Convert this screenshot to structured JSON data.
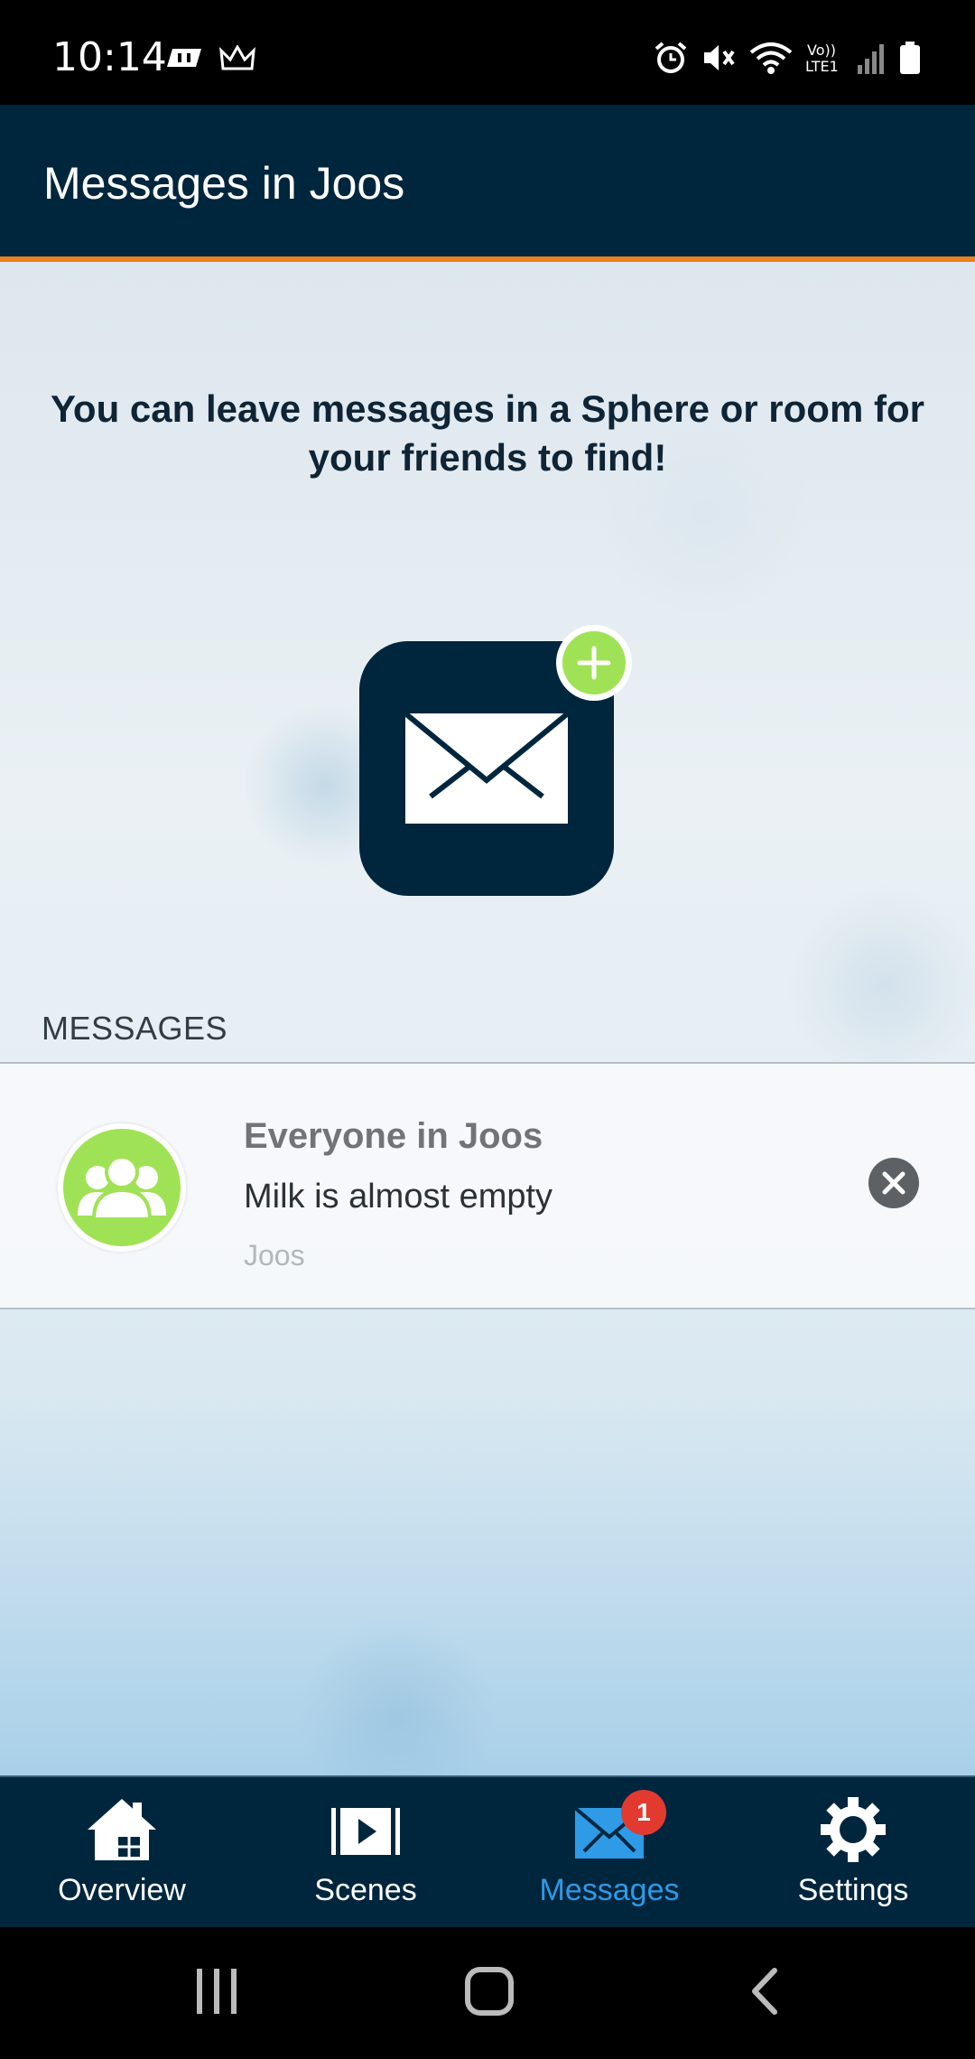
{
  "status_bar": {
    "time": "10:14",
    "icons": [
      "tools-icon",
      "crown-icon",
      "alarm-icon",
      "mute-icon",
      "wifi-icon",
      "volte-icon",
      "signal-icon",
      "battery-icon"
    ]
  },
  "header": {
    "title": "Messages in Joos"
  },
  "intro": {
    "text": "You can leave messages in a Sphere or room for your friends to find!"
  },
  "add_message_icon": "mail-add-icon",
  "messages_section": {
    "label": "MESSAGES",
    "items": [
      {
        "recipient": "Everyone in Joos",
        "body": "Milk is almost empty",
        "sphere": "Joos",
        "avatar_icon": "group-icon"
      }
    ]
  },
  "tabbar": {
    "tabs": [
      {
        "label": "Overview",
        "icon": "home-icon",
        "active": false
      },
      {
        "label": "Scenes",
        "icon": "scenes-icon",
        "active": false
      },
      {
        "label": "Messages",
        "icon": "mail-icon",
        "active": true,
        "badge": "1"
      },
      {
        "label": "Settings",
        "icon": "gear-icon",
        "active": false
      }
    ]
  },
  "colors": {
    "header_bg": "#00263e",
    "accent_line": "#e8801e",
    "active_tab": "#2f9ae6",
    "green": "#a0e255",
    "badge_red": "#e33a2f"
  }
}
